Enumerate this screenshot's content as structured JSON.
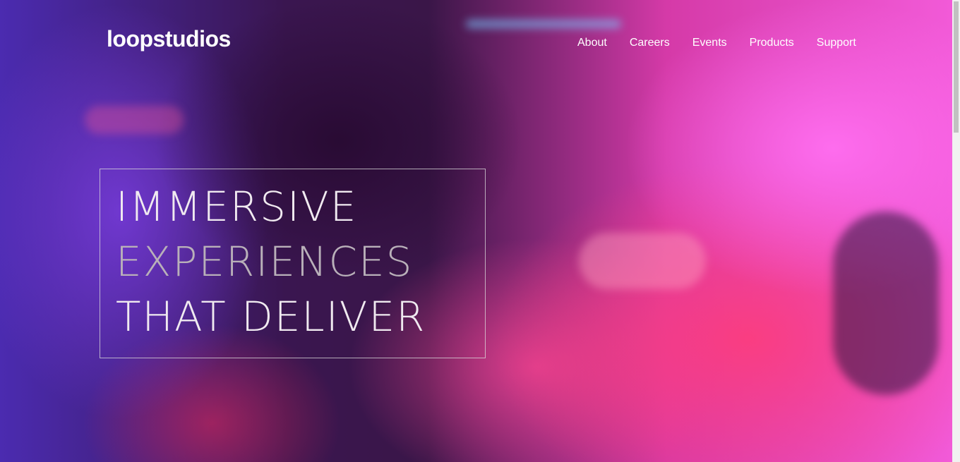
{
  "header": {
    "logo": "loopstudios",
    "nav": [
      "About",
      "Careers",
      "Events",
      "Products",
      "Support"
    ]
  },
  "hero": {
    "headline": [
      "IMMERSIVE",
      "EXPERIENCES",
      "THAT DELIVER"
    ]
  },
  "colors": {
    "text": "#ffffff",
    "headline_dim": "#b9b0b9",
    "box_border": "#dcdcdc"
  }
}
